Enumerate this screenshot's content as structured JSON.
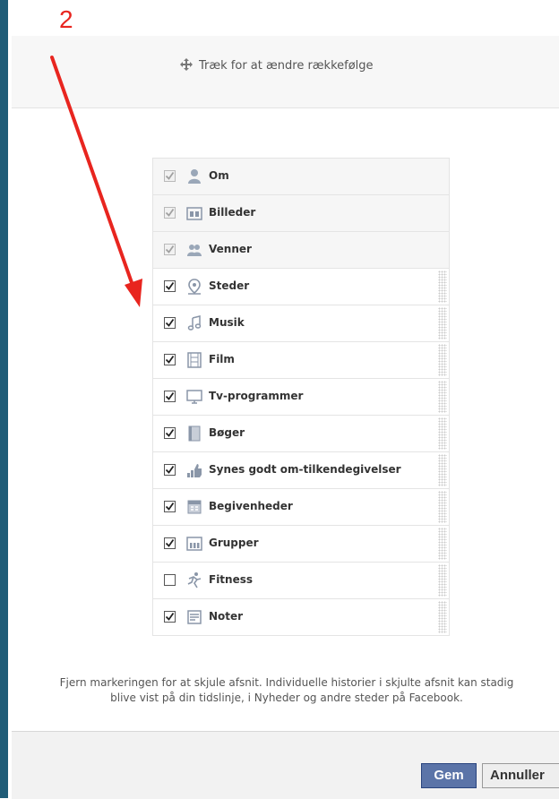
{
  "annotation": {
    "step_number": "2"
  },
  "header": {
    "drag_hint": "Træk for at ændre rækkefølge",
    "move_icon": "move-arrows-icon"
  },
  "sections": [
    {
      "label": "Om",
      "checked": true,
      "locked": true,
      "icon": "person-icon"
    },
    {
      "label": "Billeder",
      "checked": true,
      "locked": true,
      "icon": "photos-icon"
    },
    {
      "label": "Venner",
      "checked": true,
      "locked": true,
      "icon": "friends-icon"
    },
    {
      "label": "Steder",
      "checked": true,
      "locked": false,
      "icon": "map-pin-icon"
    },
    {
      "label": "Musik",
      "checked": true,
      "locked": false,
      "icon": "music-note-icon"
    },
    {
      "label": "Film",
      "checked": true,
      "locked": false,
      "icon": "film-icon"
    },
    {
      "label": "Tv-programmer",
      "checked": true,
      "locked": false,
      "icon": "tv-icon"
    },
    {
      "label": "Bøger",
      "checked": true,
      "locked": false,
      "icon": "book-icon"
    },
    {
      "label": "Synes godt om-tilkendegivelser",
      "checked": true,
      "locked": false,
      "icon": "thumbs-up-icon"
    },
    {
      "label": "Begivenheder",
      "checked": true,
      "locked": false,
      "icon": "calendar-icon"
    },
    {
      "label": "Grupper",
      "checked": true,
      "locked": false,
      "icon": "groups-icon"
    },
    {
      "label": "Fitness",
      "checked": false,
      "locked": false,
      "icon": "runner-icon"
    },
    {
      "label": "Noter",
      "checked": true,
      "locked": false,
      "icon": "notes-icon"
    }
  ],
  "footnote": {
    "line1": "Fjern markeringen for at skjule afsnit. Individuelle historier i skjulte afsnit kan stadig",
    "line2": "blive vist på din tidslinje, i Nyheder og andre steder på Facebook."
  },
  "buttons": {
    "save": "Gem",
    "cancel": "Annuller"
  },
  "colors": {
    "annotation": "#e8251f",
    "save_button": "#5b74a8",
    "sidebar": "#1f5c77"
  }
}
